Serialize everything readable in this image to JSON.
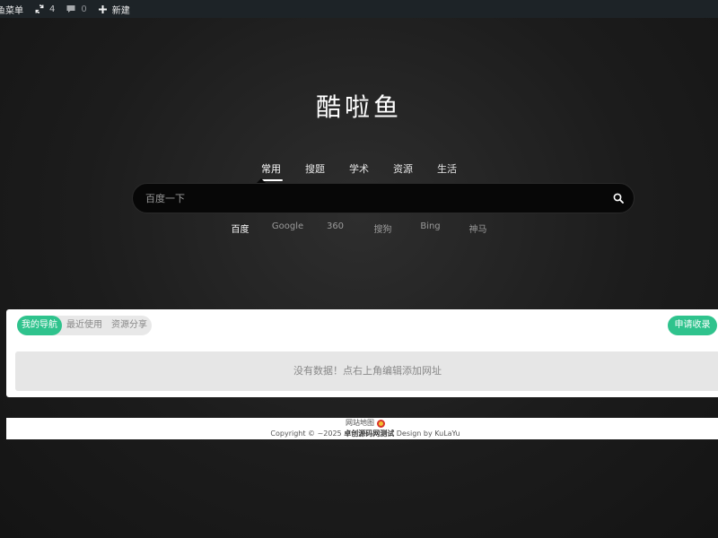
{
  "adminbar": {
    "menu_label": "鱼菜单",
    "updates_count": "4",
    "comments_count": "0",
    "new_label": "新建"
  },
  "site": {
    "title": "酷啦鱼"
  },
  "search": {
    "tabs": [
      "常用",
      "搜题",
      "学术",
      "资源",
      "生活"
    ],
    "active_tab": "常用",
    "placeholder": "百度一下",
    "engines": [
      "百度",
      "Google",
      "360",
      "搜狗",
      "Bing",
      "神马"
    ],
    "active_engine": "百度"
  },
  "nav": {
    "pills": [
      "我的导航",
      "最近使用",
      "资源分享"
    ],
    "active_pill": "我的导航",
    "apply_label": "申请收录",
    "empty_text": "没有数据！点右上角编辑添加网址"
  },
  "footer": {
    "sitemap_label": "网站地图",
    "copyright_prefix": "Copyright © ~2025",
    "site_name": "卓创源码网测试",
    "design_by": "Design by KuLaYu"
  },
  "colors": {
    "accent": "#2fc38d",
    "adminbar_bg": "#1d2327",
    "search_bg": "#070707"
  }
}
